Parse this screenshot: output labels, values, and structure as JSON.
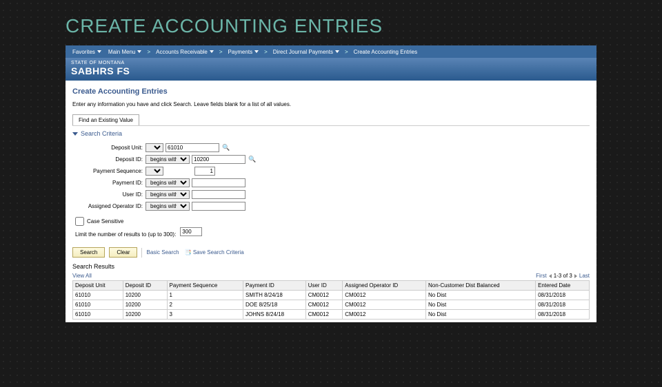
{
  "slide_title": "CREATE ACCOUNTING ENTRIES",
  "nav": {
    "favorites": "Favorites",
    "main_menu": "Main Menu",
    "accounts_receivable": "Accounts Receivable",
    "payments": "Payments",
    "direct_journal": "Direct Journal Payments",
    "create_entries": "Create Accounting Entries"
  },
  "banner": {
    "state": "STATE OF MONTANA",
    "brand": "SABHRS FS"
  },
  "page": {
    "title": "Create Accounting Entries",
    "instructions": "Enter any information you have and click Search. Leave fields blank for a list of all values.",
    "tab": "Find an Existing Value",
    "section": "Search Criteria"
  },
  "criteria": {
    "deposit_unit": {
      "label": "Deposit Unit:",
      "op": "=",
      "value": "61010"
    },
    "deposit_id": {
      "label": "Deposit ID:",
      "op": "begins with",
      "value": "10200"
    },
    "payment_seq": {
      "label": "Payment Sequence:",
      "op": "=",
      "value": "1"
    },
    "payment_id": {
      "label": "Payment ID:",
      "op": "begins with",
      "value": ""
    },
    "user_id": {
      "label": "User ID:",
      "op": "begins with",
      "value": ""
    },
    "assigned_op": {
      "label": "Assigned Operator ID:",
      "op": "begins with",
      "value": ""
    }
  },
  "case_sensitive": "Case Sensitive",
  "limit": {
    "label": "Limit the number of results to (up to 300):",
    "value": "300"
  },
  "buttons": {
    "search": "Search",
    "clear": "Clear",
    "basic": "Basic Search",
    "save_crit": "Save Search Criteria"
  },
  "results": {
    "header": "Search Results",
    "viewall": "View All",
    "first": "First",
    "last": "Last",
    "range": "1-3 of 3",
    "columns": [
      "Deposit Unit",
      "Deposit ID",
      "Payment Sequence",
      "Payment ID",
      "User ID",
      "Assigned Operator ID",
      "Non-Customer Dist Balanced",
      "Entered Date"
    ],
    "rows": [
      [
        "61010",
        "10200",
        "1",
        "SMITH 8/24/18",
        "CM0012",
        "CM0012",
        "No Dist",
        "08/31/2018"
      ],
      [
        "61010",
        "10200",
        "2",
        "DOE 8/25/18",
        "CM0012",
        "CM0012",
        "No Dist",
        "08/31/2018"
      ],
      [
        "61010",
        "10200",
        "3",
        "JOHNS 8/24/18",
        "CM0012",
        "CM0012",
        "No Dist",
        "08/31/2018"
      ]
    ]
  }
}
